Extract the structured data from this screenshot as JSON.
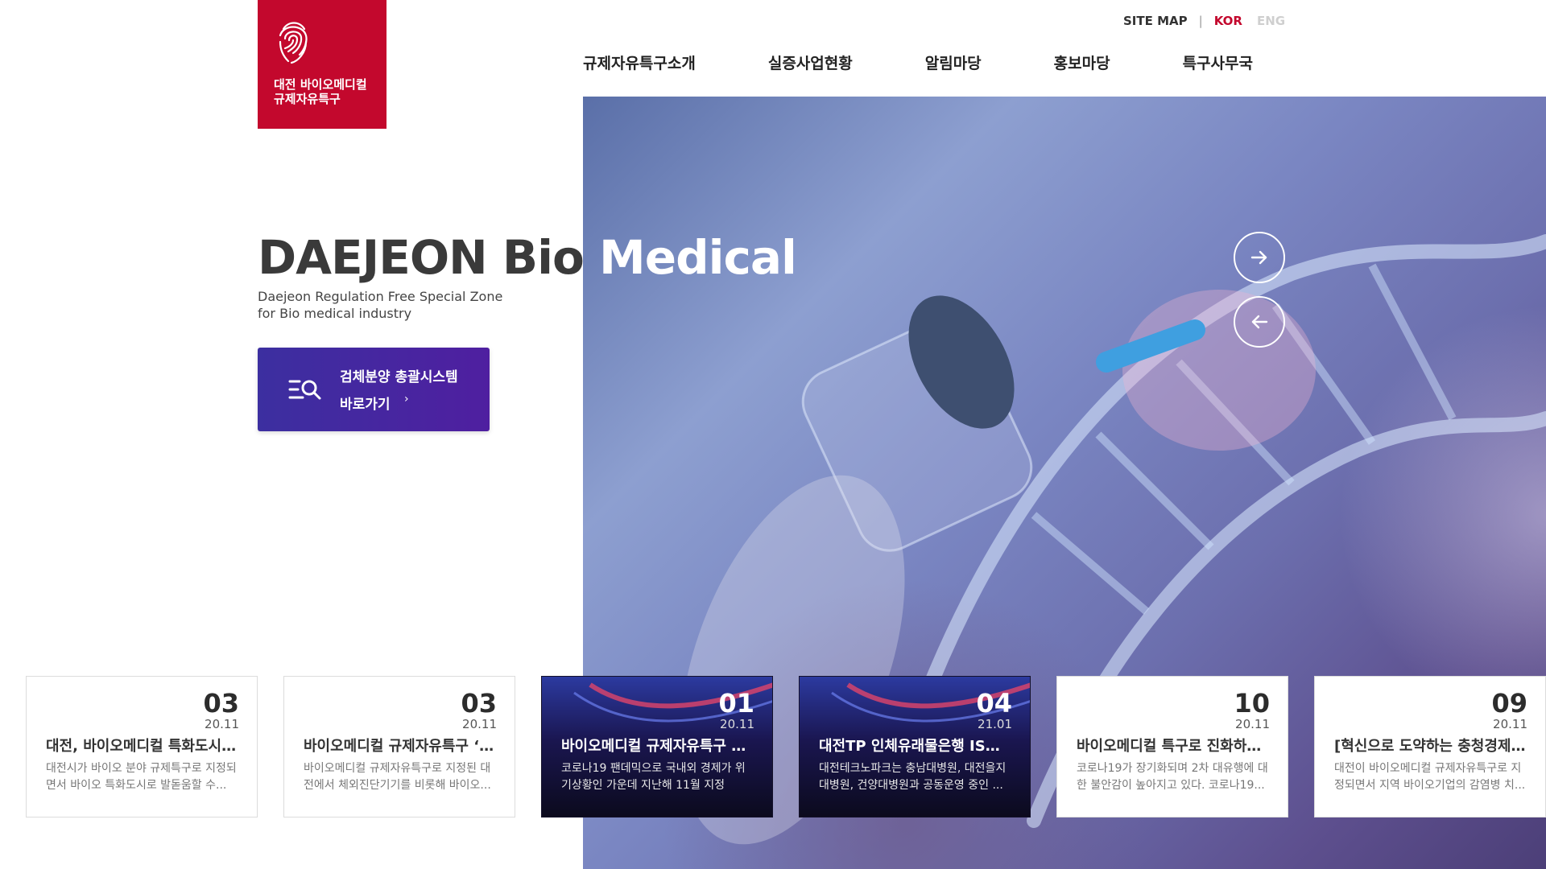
{
  "logo": {
    "line1": "대전 바이오메디컬",
    "line2": "규제자유특구"
  },
  "utility": {
    "sitemap": "SITE MAP",
    "divider": "|",
    "kor": "KOR",
    "eng": "ENG"
  },
  "nav": {
    "items": [
      {
        "label": "규제자유특구소개"
      },
      {
        "label": "실증사업현황"
      },
      {
        "label": "알림마당"
      },
      {
        "label": "홍보마당"
      },
      {
        "label": "특구사무국"
      }
    ]
  },
  "hero": {
    "title": "DAEJEON Bio Medical",
    "subtitle_line1": "Daejeon Regulation Free Special Zone",
    "subtitle_line2": "for Bio medical industry",
    "cta_line1": "검체분양 총괄시스템",
    "cta_line2": "바로가기",
    "cta_chevron": "›"
  },
  "colors": {
    "brand_red": "#c3082d",
    "cta_purple": "#3c2fa0"
  },
  "news": [
    {
      "day": "03",
      "ym": "20.11",
      "title": "대전, 바이오메디컬 특화도시 ‘...",
      "desc": "대전시가 바이오 분야 규제특구로 지정되면서 바이오 특화도시로 발돋움할 수...",
      "style": "light"
    },
    {
      "day": "03",
      "ym": "20.11",
      "title": "바이오메디컬 규제자유특구 ‘대...",
      "desc": "바이오메디컬 규제자유특구로 지정된 대전에서 체외진단기기를 비롯해 바이오...",
      "style": "light"
    },
    {
      "day": "01",
      "ym": "20.11",
      "title": "바이오메디컬 규제자유특구 대...",
      "desc": "코로나19 팬데믹으로 국내외 경제가 위기상황인 가운데 지난해 11월 지정된‘대...",
      "style": "dark"
    },
    {
      "day": "04",
      "ym": "21.01",
      "title": "대전TP 인체유래물은행 ISO 9...",
      "desc": "대전테크노파크는 충남대병원, 대전을지대병원, 건양대병원과 공동운영 중인 ...",
      "style": "dark"
    },
    {
      "day": "10",
      "ym": "20.11",
      "title": "바이오메디컬 특구로 진화하는 ...",
      "desc": "코로나19가 장기화되며 2차 대유행에 대한 불안감이 높아지고 있다. 코로나19...",
      "style": "light"
    },
    {
      "day": "09",
      "ym": "20.11",
      "title": "[혁신으로 도약하는 충청경제]...",
      "desc": "대전이 바이오메디컬 규제자유특구로 지정되면서 지역 바이오기업의 감염병 치...",
      "style": "light"
    }
  ]
}
